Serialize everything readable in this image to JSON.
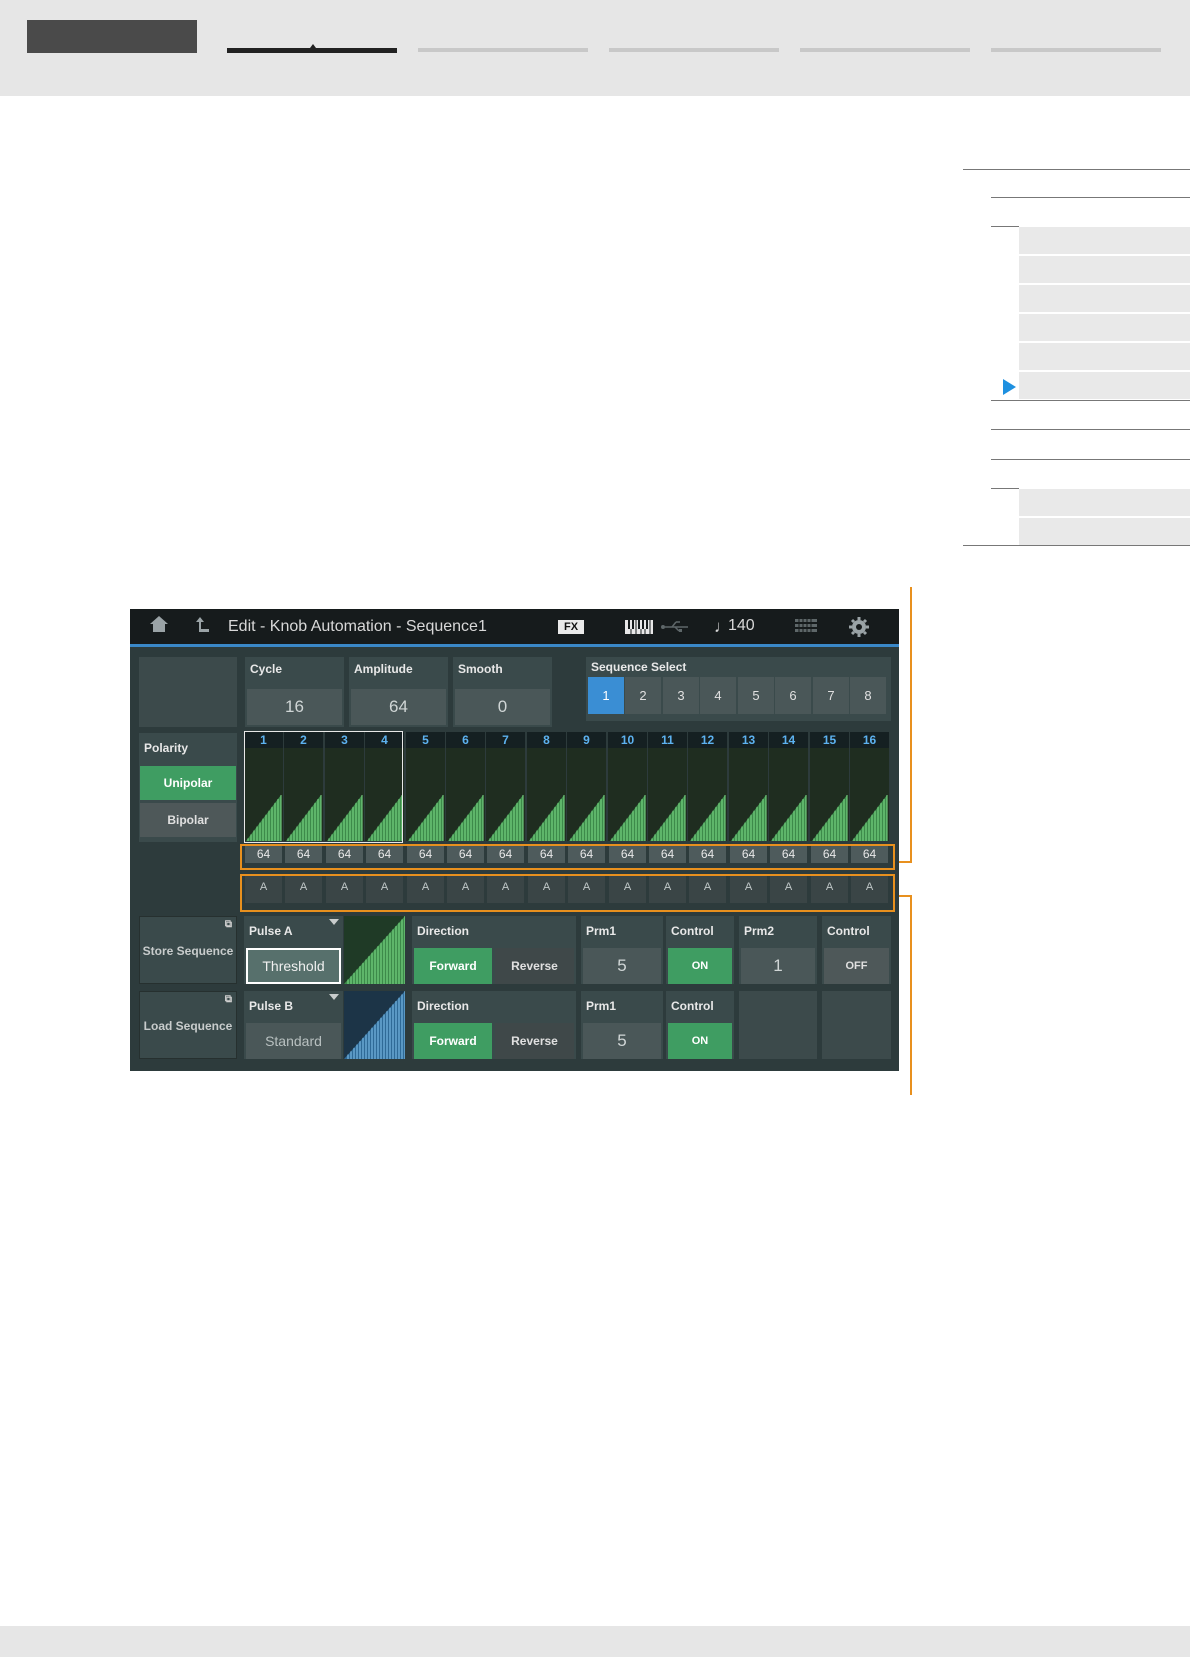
{
  "screen": {
    "title": "Edit - Knob Automation - Sequence1",
    "fx_label": "FX",
    "tempo_symbol": "♩",
    "tempo": "140",
    "icons": [
      "home-icon",
      "up-arrow-icon",
      "keyboard-icon",
      "usb-icon",
      "grid-icon",
      "gear-icon"
    ],
    "params": {
      "cycle": {
        "label": "Cycle",
        "value": "16"
      },
      "amplitude": {
        "label": "Amplitude",
        "value": "64"
      },
      "smooth": {
        "label": "Smooth",
        "value": "0"
      }
    },
    "sequence_select": {
      "label": "Sequence Select",
      "buttons": [
        "1",
        "2",
        "3",
        "4",
        "5",
        "6",
        "7",
        "8"
      ],
      "selected": "1"
    },
    "polarity": {
      "label": "Polarity",
      "options": [
        "Unipolar",
        "Bipolar"
      ],
      "selected": "Unipolar"
    },
    "steps": {
      "numbers": [
        "1",
        "2",
        "3",
        "4",
        "5",
        "6",
        "7",
        "8",
        "9",
        "10",
        "11",
        "12",
        "13",
        "14",
        "15",
        "16"
      ],
      "values": [
        "64",
        "64",
        "64",
        "64",
        "64",
        "64",
        "64",
        "64",
        "64",
        "64",
        "64",
        "64",
        "64",
        "64",
        "64",
        "64"
      ],
      "curves": [
        "A",
        "A",
        "A",
        "A",
        "A",
        "A",
        "A",
        "A",
        "A",
        "A",
        "A",
        "A",
        "A",
        "A",
        "A",
        "A"
      ],
      "selected_range": "1-4"
    },
    "store_sequence": "Store Sequence",
    "load_sequence": "Load Sequence",
    "pulse_a": {
      "label": "Pulse A",
      "type": "Threshold",
      "direction_label": "Direction",
      "forward": "Forward",
      "reverse": "Reverse",
      "prm1_label": "Prm1",
      "prm1_value": "5",
      "control1_label": "Control",
      "control1_value": "ON",
      "prm2_label": "Prm2",
      "prm2_value": "1",
      "control2_label": "Control",
      "control2_value": "OFF"
    },
    "pulse_b": {
      "label": "Pulse B",
      "type": "Standard",
      "direction_label": "Direction",
      "forward": "Forward",
      "reverse": "Reverse",
      "prm1_label": "Prm1",
      "prm1_value": "5",
      "control_label": "Control",
      "control_value": "ON"
    }
  },
  "colors": {
    "accent_blue": "#3a8ed4",
    "on_green": "#3f9d62",
    "callout_orange": "#e8901e",
    "toc_pointer": "#1e90e0"
  }
}
